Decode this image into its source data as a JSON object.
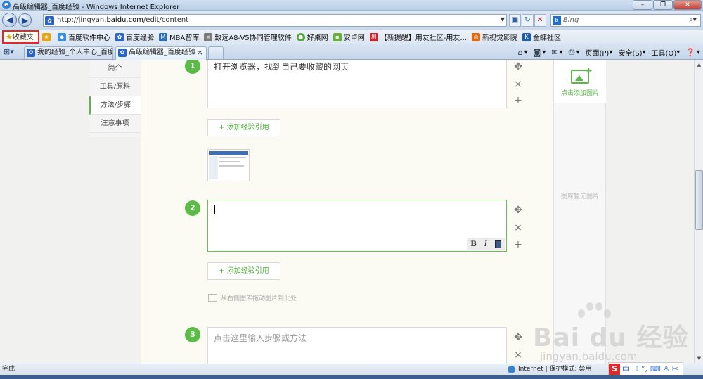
{
  "window": {
    "title": "高级编辑器_百度经验 - Windows Internet Explorer",
    "controls": [
      "–",
      "❐",
      "✕"
    ]
  },
  "navbar": {
    "url_prefix": "http://jingyan.",
    "url_domain": "baidu.com",
    "url_path": "/edit/content",
    "search_placeholder": "Bing",
    "search_engine_icon": "bing-icon"
  },
  "favorites": {
    "button_label": "收藏夹",
    "items": [
      {
        "label": "百度软件中心",
        "color": "#3a8ee6"
      },
      {
        "label": "百度经验",
        "color": "#2a63c9"
      },
      {
        "label": "MBA智库",
        "color": "#2c6fb5"
      },
      {
        "label": "致远A8-V5协同管理软件",
        "color": "#7a7a7a"
      },
      {
        "label": "好桌网",
        "color": "#56a83a"
      },
      {
        "label": "安卓网",
        "color": "#67b03a"
      },
      {
        "label": "【新提醒】用友社区-用友...",
        "color": "#c9262b"
      },
      {
        "label": "新视觉影院",
        "color": "#e06a10"
      },
      {
        "label": "金蝶社区",
        "color": "#1d5fa8"
      }
    ]
  },
  "tabs": [
    {
      "label": "我的经验_个人中心_百度...",
      "active": false
    },
    {
      "label": "高级编辑器_百度经验",
      "active": true
    }
  ],
  "commandbar": {
    "page": "页面(P)",
    "safety": "安全(S)",
    "tools": "工具(O)"
  },
  "leftnav": [
    "简介",
    "工具/原料",
    "方法/步骤",
    "注意事项"
  ],
  "leftnav_selected": "方法/步骤",
  "steps": [
    {
      "number": "1",
      "text": "打开浏览器，找到自己要收藏的网页"
    },
    {
      "number": "2",
      "text": ""
    },
    {
      "number": "3",
      "placeholder": "点击这里输入步骤或方法"
    }
  ],
  "editor": {
    "add_reference": "+ 添加经验引用",
    "format_bold": "B",
    "format_italic": "I",
    "drop_tip": "从右侧图库拖动图片到此处",
    "add_image": "点击添加图片",
    "no_images": "图库暂无图片"
  },
  "watermark": {
    "brand": "Bai du 经验",
    "sub": "jingyan.baidu.com"
  },
  "status": {
    "done": "完成",
    "zone": "Internet | 保护模式: 禁用"
  },
  "colors": {
    "accent_green": "#5abb46",
    "fav_highlight": "#e0282d"
  }
}
